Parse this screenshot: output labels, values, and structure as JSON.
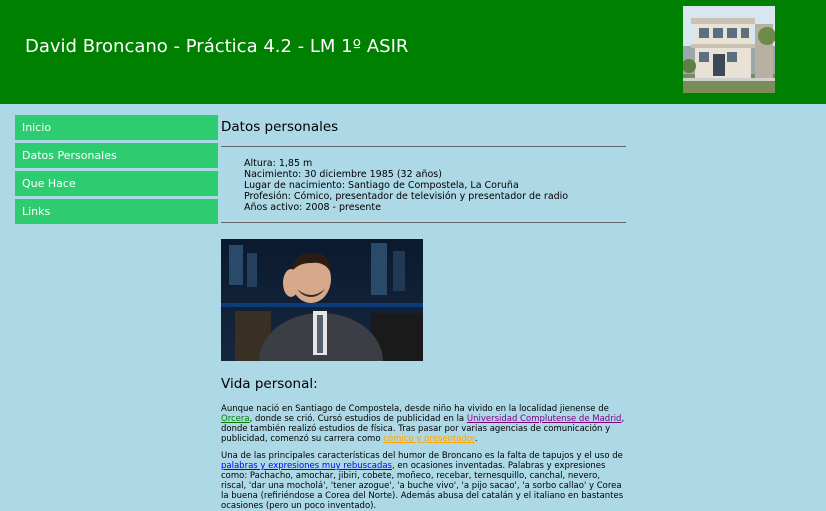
{
  "header": {
    "title": "David Broncano - Práctica 4.2 - LM 1º ASIR"
  },
  "nav": {
    "items": [
      "Inicio",
      "Datos Personales",
      "Que Hace",
      "Links"
    ]
  },
  "main": {
    "section_title": "Datos personales",
    "facts": [
      "Altura: 1,85 m",
      "Nacimiento: 30 diciembre 1985 (32 años)",
      "Lugar de nacimiento: Santiago de Compostela, La Coruña",
      "Profesión: Cómico, presentador de televisión y presentador de radio",
      "Años activo: 2008 - presente"
    ],
    "vida_title": "Vida personal:",
    "p1": {
      "t1": "Aunque nació en Santiago de Compostela, desde niño ha vivido en la localidad jienense de ",
      "l1": "Orcera",
      "t2": ", donde se crió. Cursó estudios de publicidad en la ",
      "l2": "Universidad Complutense de Madrid",
      "t3": ", donde también realizó estudios de física. Tras pasar por varias agencias de comunicación y publicidad, comenzó su carrera como ",
      "l3": "cómico y presentador",
      "t4": "."
    },
    "p2": {
      "t1": "Una de las principales características del humor de Broncano es la falta de tapujos y el uso de ",
      "l1": "palabras y expresiones muy rebuscadas",
      "t2": ", en ocasiones inventadas. Palabras y expresiones como: Pachacho, amochar, jibiri, cobete, moñeco, recebar, ternesquillo, canchal, nevero, riscal, 'dar una mocholá', 'tener azogue', 'a buche vivo', 'a pijo sacao', 'a sorbo callao' y Corea la buena (refiriéndose a Corea del Norte). Además abusa del catalán y el italiano en bastantes ocasiones (pero un poco inventado)."
    }
  },
  "colors": {
    "header_bg": "#008000",
    "body_bg": "#add8e6",
    "nav_bg": "#2ecc71"
  }
}
